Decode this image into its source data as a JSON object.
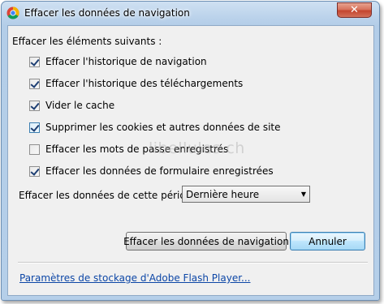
{
  "window": {
    "title": "Effacer les données de navigation",
    "close_glyph": "✕",
    "icon": "chrome-icon"
  },
  "form": {
    "section_label": "Effacer les éléments suivants :",
    "options": [
      {
        "label": "Effacer l'historique de navigation",
        "checked": true
      },
      {
        "label": "Effacer l'historique des téléchargements",
        "checked": true
      },
      {
        "label": "Vider le cache",
        "checked": true
      },
      {
        "label": "Supprimer les cookies et autres données de site",
        "checked": true
      },
      {
        "label": "Effacer les mots de passe enregistrés",
        "checked": false
      },
      {
        "label": "Effacer les données de formulaire enregistrées",
        "checked": true
      }
    ],
    "period_label": "Effacer les données de cette période :",
    "period_selected": "Dernière heure"
  },
  "buttons": {
    "clear_label": "Effacer les données de navigation",
    "cancel_label": "Annuler"
  },
  "footer": {
    "link_text": "Paramètres de stockage d'Adobe Flash Player..."
  },
  "watermark": "libellules.ch"
}
